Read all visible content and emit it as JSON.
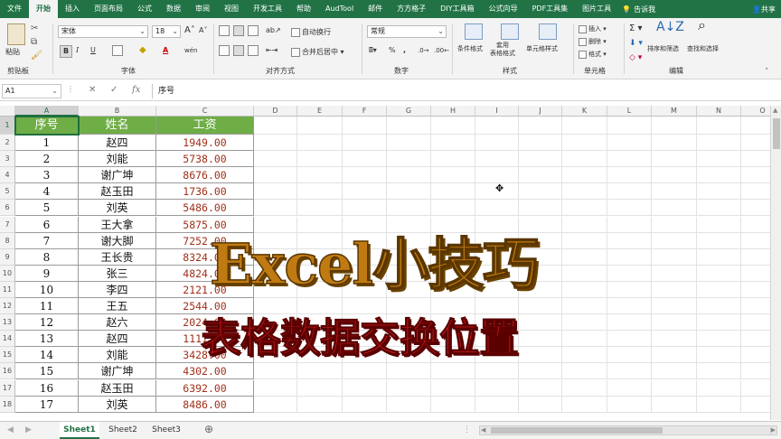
{
  "menubar": {
    "tabs": [
      "文件",
      "开始",
      "插入",
      "页面布局",
      "公式",
      "数据",
      "审阅",
      "视图",
      "开发工具",
      "帮助",
      "AudTool",
      "邮件",
      "方方格子",
      "DIY工具箱",
      "公式向导",
      "PDF工具集",
      "图片工具"
    ],
    "active_tab": "开始",
    "search_label": "告诉我",
    "share_label": "共享"
  },
  "ribbon": {
    "clipboard": {
      "paste": "粘贴",
      "label": "剪贴板"
    },
    "font": {
      "name": "宋体",
      "size": "18",
      "grow": "A",
      "shrink": "A",
      "bold": "B",
      "italic": "I",
      "underline": "U",
      "wen": "wén",
      "label": "字体"
    },
    "alignment": {
      "wrap": "自动换行",
      "merge": "合并后居中",
      "label": "对齐方式"
    },
    "number": {
      "format": "常规",
      "percent": "%",
      "comma": ",",
      "label": "数字"
    },
    "styles": {
      "conditional": "条件格式",
      "table": "套用\n表格格式",
      "cell": "单元格样式",
      "label": "样式"
    },
    "cells": {
      "insert": "插入",
      "delete": "删除",
      "format": "格式",
      "label": "单元格"
    },
    "editing": {
      "sort": "排序和筛选",
      "find": "查找和选择",
      "label": "编辑"
    }
  },
  "formula_bar": {
    "name_box": "A1",
    "content": "序号",
    "fx": "fx"
  },
  "columns": [
    "A",
    "B",
    "C",
    "D",
    "E",
    "F",
    "G",
    "H",
    "I",
    "J",
    "K",
    "L",
    "M",
    "N",
    "O"
  ],
  "rows": [
    "1",
    "2",
    "3",
    "4",
    "5",
    "6",
    "7",
    "8",
    "9",
    "10",
    "11",
    "12",
    "13",
    "14",
    "15",
    "16",
    "17",
    "18"
  ],
  "table": {
    "headers": [
      "序号",
      "姓名",
      "工资"
    ],
    "data": [
      [
        "1",
        "赵四",
        "1949.00"
      ],
      [
        "2",
        "刘能",
        "5738.00"
      ],
      [
        "3",
        "谢广坤",
        "8676.00"
      ],
      [
        "4",
        "赵玉田",
        "1736.00"
      ],
      [
        "5",
        "刘英",
        "5486.00"
      ],
      [
        "6",
        "王大拿",
        "5875.00"
      ],
      [
        "7",
        "谢大脚",
        "7252.00"
      ],
      [
        "8",
        "王长贵",
        "8324.00"
      ],
      [
        "9",
        "张三",
        "4824.00"
      ],
      [
        "10",
        "李四",
        "2121.00"
      ],
      [
        "11",
        "王五",
        "2544.00"
      ],
      [
        "12",
        "赵六",
        "2024.00"
      ],
      [
        "13",
        "赵四",
        "1111.00"
      ],
      [
        "14",
        "刘能",
        "3428.00"
      ],
      [
        "15",
        "谢广坤",
        "4302.00"
      ],
      [
        "16",
        "赵玉田",
        "6392.00"
      ],
      [
        "17",
        "刘英",
        "8486.00"
      ]
    ]
  },
  "overlay": {
    "title": "Excel小技巧",
    "subtitle": "表格数据交换位置"
  },
  "sheet_tabs": [
    "Sheet1",
    "Sheet2",
    "Sheet3"
  ],
  "active_sheet": "Sheet1",
  "colors": {
    "excel_green": "#217346",
    "header_fill": "#6fad46",
    "salary_text": "#a0301a",
    "title_orange": "#c07a12",
    "subtitle_red": "#c41818"
  }
}
